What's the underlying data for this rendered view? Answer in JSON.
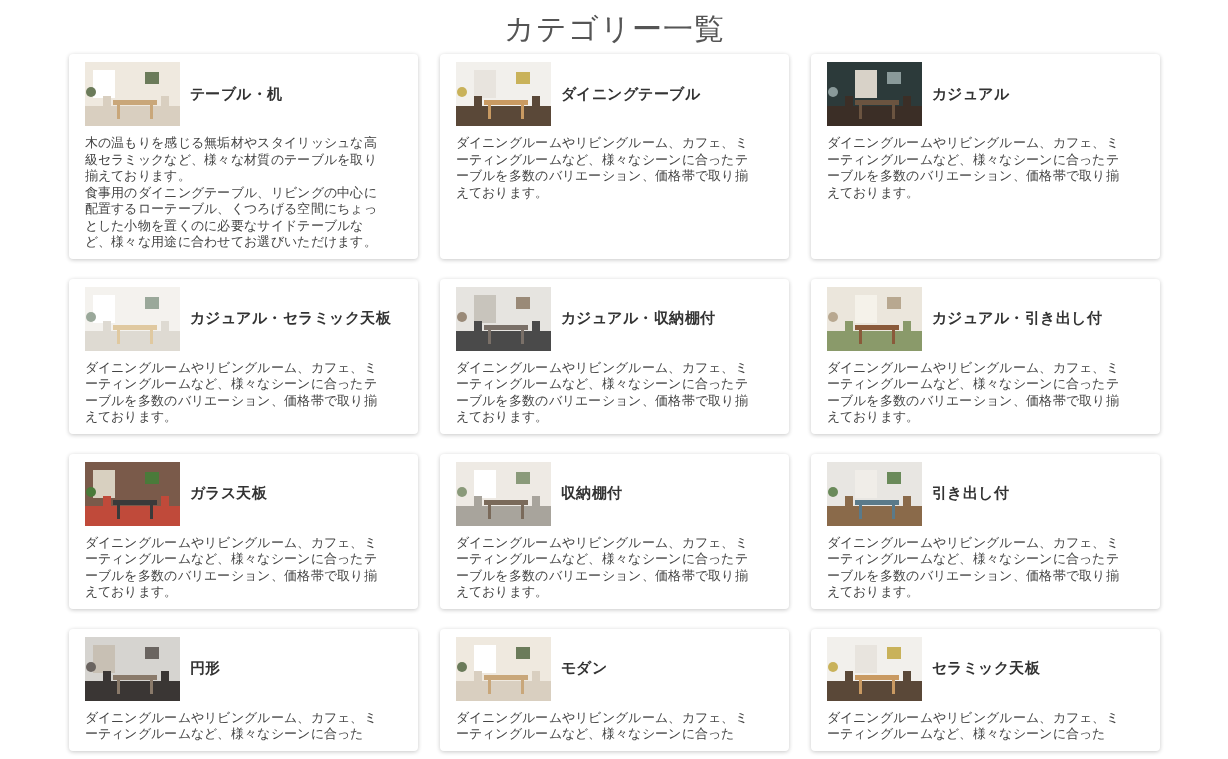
{
  "title": "カテゴリー一覧",
  "categories": [
    {
      "name": "テーブル・机",
      "description": "木の温もりを感じる無垢材やスタイリッシュな高級セラミックなど、様々な材質のテーブルを取り揃えております。",
      "note": "食事用のダイニングテーブル、リビングの中心に配置するローテーブル、くつろげる空間にちょっとした小物を置くのに必要なサイドテーブルなど、様々な用途に合わせてお選びいただけます。"
    },
    {
      "name": "ダイニングテーブル",
      "description": "ダイニングルームやリビングルーム、カフェ、ミーティングルームなど、様々なシーンに合ったテーブルを多数のバリエーション、価格帯で取り揃えております。"
    },
    {
      "name": "カジュアル",
      "description": "ダイニングルームやリビングルーム、カフェ、ミーティングルームなど、様々なシーンに合ったテーブルを多数のバリエーション、価格帯で取り揃えております。"
    },
    {
      "name": "カジュアル・セラミック天板",
      "description": "ダイニングルームやリビングルーム、カフェ、ミーティングルームなど、様々なシーンに合ったテーブルを多数のバリエーション、価格帯で取り揃えております。"
    },
    {
      "name": "カジュアル・収納棚付",
      "description": "ダイニングルームやリビングルーム、カフェ、ミーティングルームなど、様々なシーンに合ったテーブルを多数のバリエーション、価格帯で取り揃えております。"
    },
    {
      "name": "カジュアル・引き出し付",
      "description": "ダイニングルームやリビングルーム、カフェ、ミーティングルームなど、様々なシーンに合ったテーブルを多数のバリエーション、価格帯で取り揃えております。"
    },
    {
      "name": "ガラス天板",
      "description": "ダイニングルームやリビングルーム、カフェ、ミーティングルームなど、様々なシーンに合ったテーブルを多数のバリエーション、価格帯で取り揃えております。"
    },
    {
      "name": "収納棚付",
      "description": "ダイニングルームやリビングルーム、カフェ、ミーティングルームなど、様々なシーンに合ったテーブルを多数のバリエーション、価格帯で取り揃えております。"
    },
    {
      "name": "引き出し付",
      "description": "ダイニングルームやリビングルーム、カフェ、ミーティングルームなど、様々なシーンに合ったテーブルを多数のバリエーション、価格帯で取り揃えております。"
    },
    {
      "name": "円形",
      "description": "ダイニングルームやリビングルーム、カフェ、ミーティングルームなど、様々なシーンに合った"
    },
    {
      "name": "モダン",
      "description": "ダイニングルームやリビングルーム、カフェ、ミーティングルームなど、様々なシーンに合った"
    },
    {
      "name": "セラミック天板",
      "description": "ダイニングルームやリビングルーム、カフェ、ミーティングルームなど、様々なシーンに合った"
    }
  ]
}
